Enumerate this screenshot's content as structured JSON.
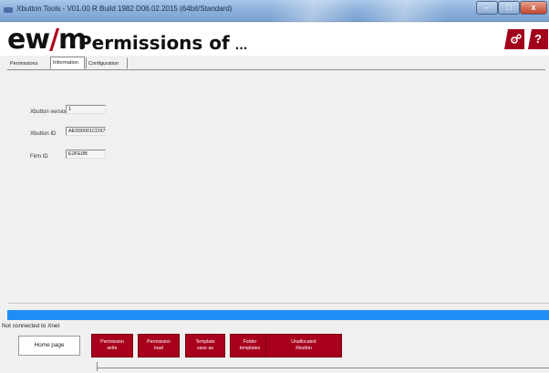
{
  "window": {
    "title": "Xbutton Tools - V01.00 R Build 1982 D06.02.2015 (64bit/Standard)",
    "min_glyph": "–",
    "max_glyph": "□",
    "close_glyph": "x"
  },
  "header": {
    "logo_left": "ew",
    "logo_slash": "/",
    "logo_right": "m",
    "title": "Permissions of",
    "title_suffix": "...",
    "settings_icon": "gears-icon",
    "help_label": "?"
  },
  "tabs": [
    {
      "label": "Permissions",
      "active": false
    },
    {
      "label": "Information",
      "active": true
    },
    {
      "label": "Configuration",
      "active": false
    }
  ],
  "info": {
    "fields": [
      {
        "label": "Xbutton version",
        "value": "1"
      },
      {
        "label": "Xbutton ID",
        "value": "AE000001CD97232"
      },
      {
        "label": "Firm ID",
        "value": "E2FE0B"
      }
    ]
  },
  "status": {
    "text": "Not connected to Xnet"
  },
  "footer": {
    "home_label": "Home page",
    "buttons": [
      {
        "line1": "Permission",
        "line2": "write"
      },
      {
        "line1": "Permission",
        "line2": "load"
      },
      {
        "line1": "Template",
        "line2": "save as"
      },
      {
        "line1": "Folder",
        "line2": "templates"
      },
      {
        "line1": "Unallocated",
        "line2": "Xbutton"
      }
    ]
  },
  "colors": {
    "brand_red": "#a8001c",
    "progress_blue": "#1f8ff5"
  }
}
